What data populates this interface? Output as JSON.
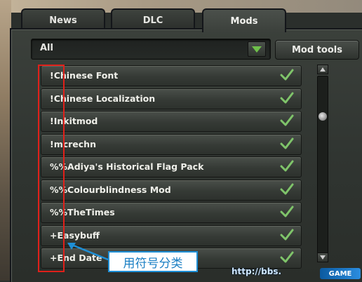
{
  "tabs": [
    {
      "label": "News"
    },
    {
      "label": "DLC"
    },
    {
      "label": "Mods",
      "active": true
    }
  ],
  "filter": {
    "selected": "All"
  },
  "toolbar": {
    "mod_tools_label": "Mod tools"
  },
  "mods": [
    {
      "name": "!Chinese Font",
      "enabled": true
    },
    {
      "name": "!Chinese Localization",
      "enabled": true
    },
    {
      "name": "!Inkitmod",
      "enabled": true
    },
    {
      "name": "!mcrechn",
      "enabled": true
    },
    {
      "name": "%%Adiya's Historical Flag Pack",
      "enabled": true
    },
    {
      "name": "%%Colourblindness Mod",
      "enabled": true
    },
    {
      "name": "%%TheTimes",
      "enabled": true
    },
    {
      "name": "+Easybuff",
      "enabled": true
    },
    {
      "name": "+End Date",
      "enabled": true
    }
  ],
  "annotation": {
    "text": "用符号分类"
  },
  "watermark": {
    "url": "http://bbs.",
    "logo": "GAME"
  },
  "colors": {
    "accent_check": "#7fc46a",
    "highlight_box": "#e0201a",
    "callout_border": "#1e8fd6"
  }
}
